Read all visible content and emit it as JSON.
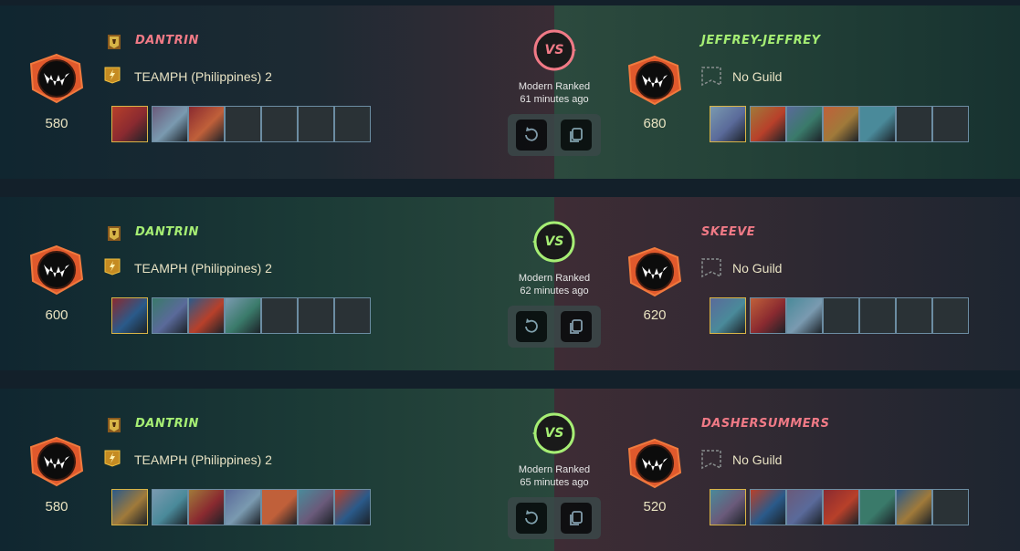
{
  "matches": [
    {
      "left": {
        "name": "DANTRIN",
        "result": "loss",
        "rating": "580",
        "clan": "TEAMPH (Philippines) 2",
        "legends": [
          "filled-main",
          "filled",
          "filled",
          "empty",
          "empty",
          "empty",
          "empty"
        ]
      },
      "right": {
        "name": "JEFFREY-JEFFREY",
        "result": "win",
        "rating": "680",
        "guild": "No Guild",
        "legends": [
          "filled-main",
          "filled",
          "filled",
          "filled",
          "filled",
          "empty",
          "empty"
        ]
      },
      "mode": "Modern Ranked",
      "time": "61 minutes ago"
    },
    {
      "left": {
        "name": "DANTRIN",
        "result": "win",
        "rating": "600",
        "clan": "TEAMPH (Philippines) 2",
        "legends": [
          "filled-main",
          "filled",
          "filled",
          "filled",
          "empty",
          "empty",
          "empty"
        ]
      },
      "right": {
        "name": "SKEEVE",
        "result": "loss",
        "rating": "620",
        "guild": "No Guild",
        "legends": [
          "filled-main",
          "filled",
          "filled",
          "empty",
          "empty",
          "empty",
          "empty"
        ]
      },
      "mode": "Modern Ranked",
      "time": "62 minutes ago"
    },
    {
      "left": {
        "name": "DANTRIN",
        "result": "win",
        "rating": "580",
        "clan": "TEAMPH (Philippines) 2",
        "legends": [
          "filled-main",
          "filled",
          "filled",
          "filled",
          "filled",
          "filled",
          "filled"
        ]
      },
      "right": {
        "name": "DASHERSUMMERS",
        "result": "loss",
        "rating": "520",
        "guild": "No Guild",
        "legends": [
          "filled-main",
          "filled",
          "filled",
          "filled",
          "filled",
          "filled",
          "empty"
        ]
      },
      "mode": "Modern Ranked",
      "time": "65 minutes ago"
    }
  ],
  "vs_label": "VS",
  "icons": {
    "rank": "fanged-rank-badge-icon",
    "clan": "clan-banner-icon",
    "team": "lightning-shield-icon",
    "guild": "empty-guild-banner-icon",
    "replay": "replay-icon",
    "copy": "copy-icon"
  },
  "colors": {
    "win": "#a6ee74",
    "loss": "#f07a86",
    "rank_orange": "#e0592c",
    "gold": "#d8b447"
  }
}
